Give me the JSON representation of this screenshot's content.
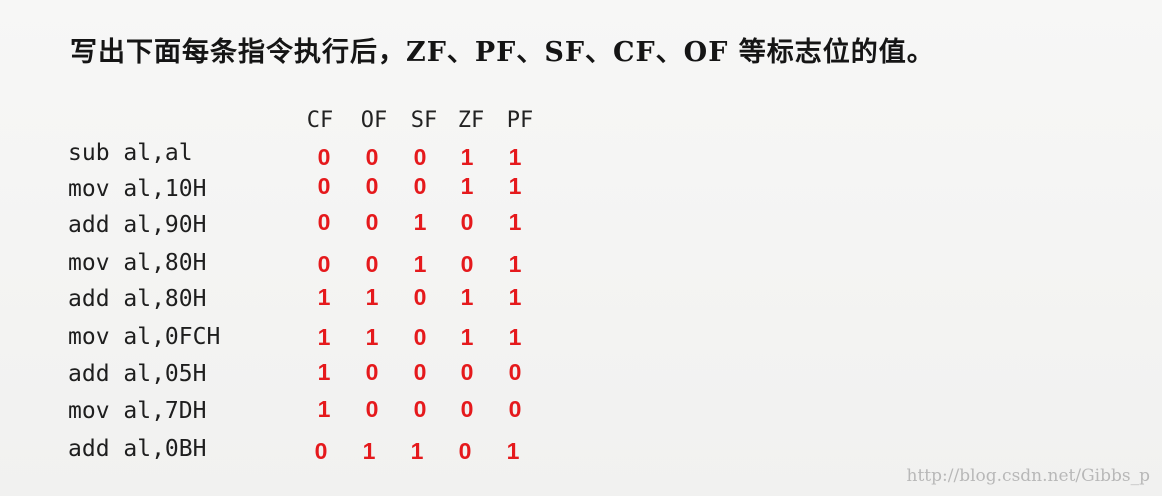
{
  "title": "写出下面每条指令执行后，ZF、PF、SF、CF、OF 等标志位的值。",
  "columns": [
    "CF",
    "OF",
    "SF",
    "ZF",
    "PF"
  ],
  "rows": [
    {
      "instruction": "sub al,al",
      "flags": [
        "0",
        "0",
        "0",
        "1",
        "1"
      ]
    },
    {
      "instruction": "mov al,10H",
      "flags": [
        "0",
        "0",
        "0",
        "1",
        "1"
      ]
    },
    {
      "instruction": "add al,90H",
      "flags": [
        "0",
        "0",
        "1",
        "0",
        "1"
      ]
    },
    {
      "instruction": "mov al,80H",
      "flags": [
        "0",
        "0",
        "1",
        "0",
        "1"
      ]
    },
    {
      "instruction": "add al,80H",
      "flags": [
        "1",
        "1",
        "0",
        "1",
        "1"
      ]
    },
    {
      "instruction": "mov al,0FCH",
      "flags": [
        "1",
        "1",
        "0",
        "1",
        "1"
      ]
    },
    {
      "instruction": "add al,05H",
      "flags": [
        "1",
        "0",
        "0",
        "0",
        "0"
      ]
    },
    {
      "instruction": "mov al,7DH",
      "flags": [
        "1",
        "0",
        "0",
        "0",
        "0"
      ]
    },
    {
      "instruction": "add al,0BH",
      "flags": [
        "0",
        "1",
        "1",
        "0",
        "1"
      ]
    }
  ],
  "watermark": "http://blog.csdn.net/Gibbs_p",
  "colors": {
    "answer": "#e5191c",
    "text": "#1a1a1a"
  }
}
